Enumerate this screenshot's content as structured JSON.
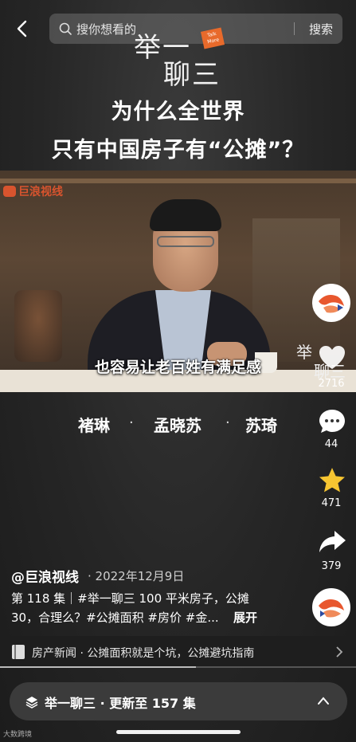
{
  "search": {
    "placeholder": "搜你想看的",
    "button": "搜索"
  },
  "show_logo": {
    "line1": "举一",
    "line2": "聊三",
    "tag": "Talk More"
  },
  "headline": {
    "line1": "为什么全世界",
    "line2": "只有中国房子有“公摊”？"
  },
  "video": {
    "watermark": "巨浪视线",
    "subtitle": "也容易让老百姓有满足感",
    "logo_small_1": "举",
    "logo_small_2": "聊三"
  },
  "guests": [
    "褚琳",
    "孟晓苏",
    "苏琦"
  ],
  "guest_separator": "·",
  "rail": {
    "likes": "2716",
    "comments": "44",
    "favorites": "471",
    "shares": "379"
  },
  "post": {
    "author": "@巨浪视线",
    "date": "· 2022年12月9日",
    "desc_line1": "第 118 集｜#举一聊三 100 平米房子，公摊",
    "desc_line2": "30，合理么？#公摊面积 #房价 #金...",
    "expand": "展开"
  },
  "news": {
    "text": "房产新闻 · 公摊面积就是个坑，公摊避坑指南"
  },
  "progress": 0.55,
  "series": {
    "text": "举一聊三 · 更新至 157 集"
  },
  "corner_watermark": "大数跨境",
  "colors": {
    "accent_orange": "#e8572e",
    "star_yellow": "#f7c531"
  }
}
